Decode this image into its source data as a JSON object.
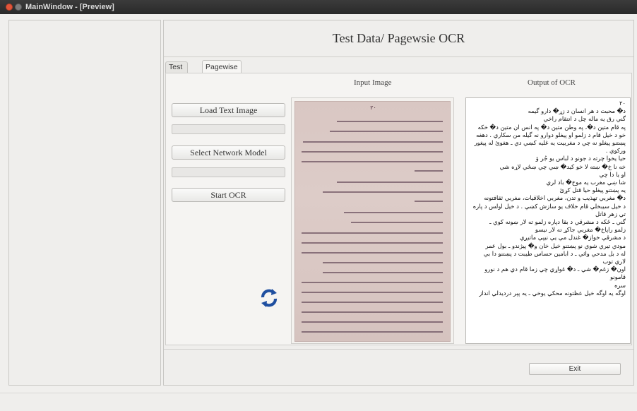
{
  "window": {
    "title": "MainWindow - [Preview]"
  },
  "header": {
    "title": "Test Data/ Pagewsie OCR"
  },
  "tabs": [
    {
      "label": "Test Data",
      "active": false
    },
    {
      "label": "Pagewise Testing (OCR)",
      "active": true
    }
  ],
  "columns": {
    "input_label": "Input Image",
    "output_label": "Output of OCR"
  },
  "buttons": {
    "load": "Load Text Image",
    "select_model": "Select Network Model",
    "start": "Start OCR",
    "exit": "Exit"
  },
  "progress": {
    "load": 0,
    "model": 0
  },
  "colors": {
    "refresh_icon": "#1f4fa0",
    "titlebar": "#2f2f2f",
    "close_button": "#e2553a"
  },
  "ocr_output": [
    "٢٠",
    "د� محبت د هر انسان د زړ� دارو گيمه",
    "گني رق يه ماله چل د انتقام راخي",
    "په قام متين د�، په وطن متين د� په انس ان متين د� خكه",
    "خو د خيل قام د زلمو او پيغلو دوارو نه گيله من سكاري . دهغه",
    "پښتنو پيغلو نه چي د مغربيت يه غليه كښي دي ـ هغوئ له پيغور",
    "وركوي .",
    "حيا يخوا چرته د جونو د لباس يو جُر ؤ",
    "خه نا خ� ښته لا خو كيد� ښي چي ښځي لاړه شي",
    "او يا دا چي",
    "شا ښي مغرب يه موخ� باد لري",
    "يه پښتنو پيغلو حيا قتل كړئ",
    "د� مغربي تهذيب و تدن، مغربي اخلاقيات، مغربي ثقافتونه",
    "د خيل سيبخلي قام خلاف يو سازش كښي . د خيل اولس د پاره",
    "تي زهر قاتل",
    "گني ـ ځکه د مشرقي د بقا دپاره زلمو ته لار ښونه كوي ـ",
    "زلمو راپاخ� مغربي جاكړ ته لار نيسو",
    "د مشرقي خواز� غندل مي يي نيپي ماتيږي",
    "مودي تيري شوي نو پښتنو خيل خان و� پيژندو ـ بول عمر",
    "له د بل مدحي واثي ـ د ابامين حساس طيبت د پښتنو دا بي",
    "لاري توب",
    "اون� زغم� شي ـ د� غواړي چي زما قام دي هم د نورو قامونو",
    "سره",
    "اوگه يه اوگه خيل عظتونه محكي يوخي ـ يه پېر درديدلي انداز"
  ],
  "scan_text": {
    "page_number": "٢٠"
  }
}
